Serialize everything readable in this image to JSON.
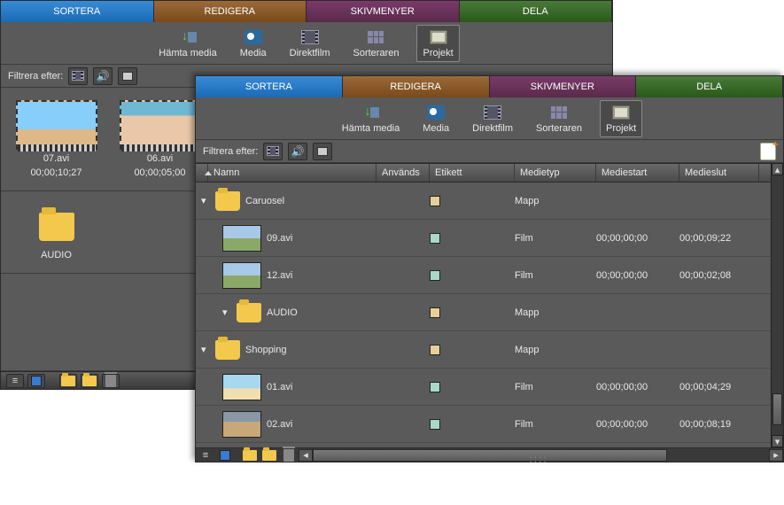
{
  "tabs": {
    "sort": "SORTERA",
    "edit": "REDIGERA",
    "disc": "SKIVMENYER",
    "share": "DELA"
  },
  "toolbar": {
    "fetch": "Hämta media",
    "media": "Media",
    "direct": "Direktfilm",
    "sorter": "Sorteraren",
    "project": "Projekt"
  },
  "filter_label": "Filtrera efter:",
  "win1": {
    "items": [
      {
        "name": "07.avi",
        "tc": "00;00;10;27"
      },
      {
        "name": "06.avi",
        "tc": "00;00;05;00"
      }
    ],
    "folder": "AUDIO"
  },
  "columns": {
    "name": "Namn",
    "used": "Används",
    "label": "Etikett",
    "type": "Medietyp",
    "start": "Mediestart",
    "end": "Medieslut"
  },
  "rows": [
    {
      "kind": "folder",
      "indent": 0,
      "expanded": true,
      "name": "Caruosel",
      "label": "tan",
      "type": "Mapp",
      "start": "",
      "end": ""
    },
    {
      "kind": "clip",
      "indent": 1,
      "thumb": "grass",
      "name": "09.avi",
      "label": "teal",
      "type": "Film",
      "start": "00;00;00;00",
      "end": "00;00;09;22"
    },
    {
      "kind": "clip",
      "indent": 1,
      "thumb": "grass",
      "name": "12.avi",
      "label": "teal",
      "type": "Film",
      "start": "00;00;00;00",
      "end": "00;00;02;08"
    },
    {
      "kind": "folder",
      "indent": 1,
      "expanded": true,
      "name": "AUDIO",
      "label": "tan",
      "type": "Mapp",
      "start": "",
      "end": ""
    },
    {
      "kind": "folder",
      "indent": 0,
      "expanded": true,
      "name": "Shopping",
      "label": "tan",
      "type": "Mapp",
      "start": "",
      "end": ""
    },
    {
      "kind": "clip",
      "indent": 1,
      "thumb": "beach",
      "name": "01.avi",
      "label": "teal",
      "type": "Film",
      "start": "00;00;00;00",
      "end": "00;00;04;29"
    },
    {
      "kind": "clip",
      "indent": 1,
      "thumb": "people",
      "name": "02.avi",
      "label": "teal",
      "type": "Film",
      "start": "00;00;00;00",
      "end": "00;00;08;19"
    }
  ]
}
